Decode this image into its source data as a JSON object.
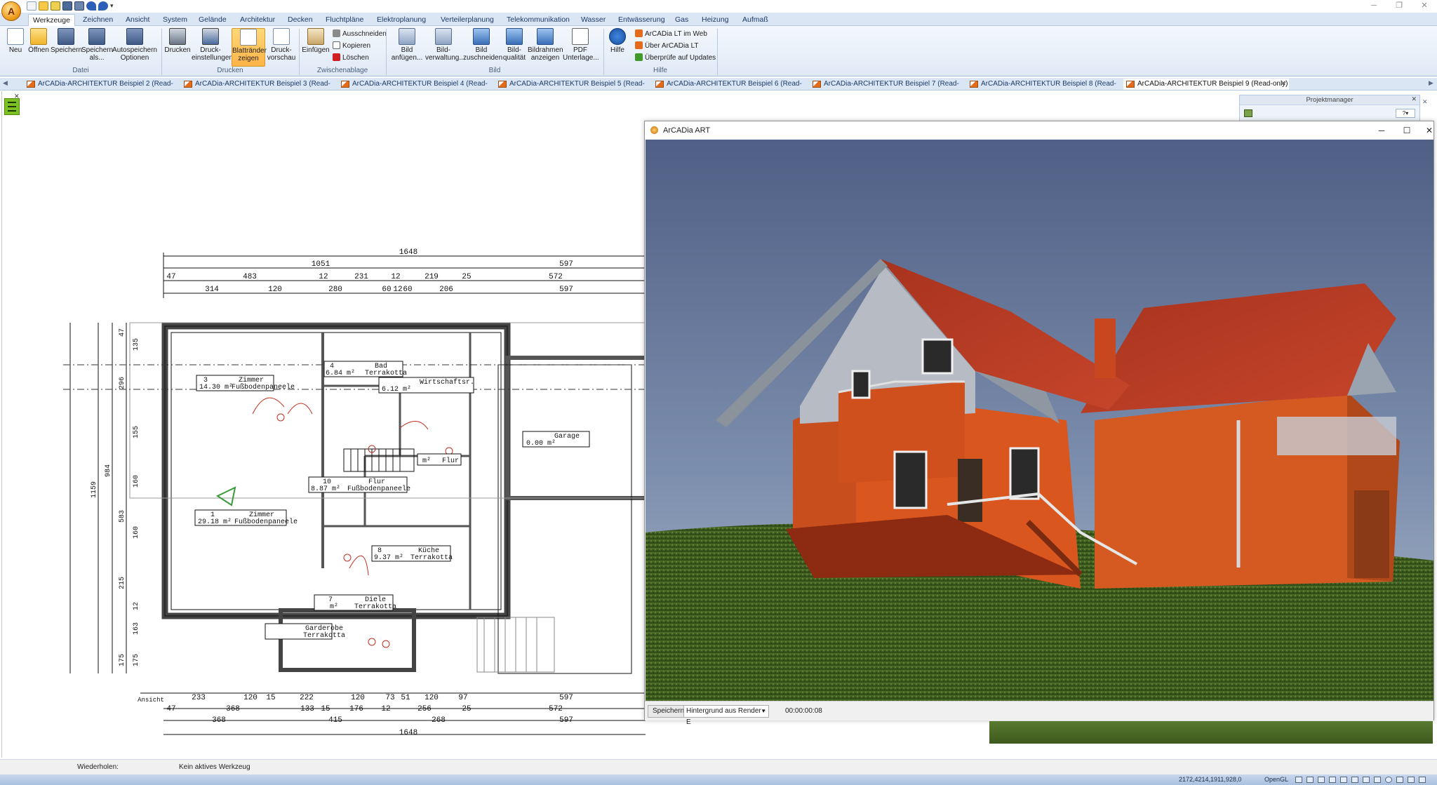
{
  "ribbon_tabs": [
    "Werkzeuge",
    "Zeichnen",
    "Ansicht",
    "System",
    "Gelände",
    "Architektur",
    "Decken",
    "Fluchtpläne",
    "Elektroplanung",
    "Verteilerplanung",
    "Telekommunikation",
    "Wasser",
    "Entwässerung",
    "Gas",
    "Heizung",
    "Aufmaß"
  ],
  "ribbon": {
    "datei": {
      "group": "Datei",
      "neu": "Neu",
      "oeffnen": "Öffnen",
      "speichern": "Speichern",
      "speichern_als": "Speichern als...",
      "autospeichern": "Autospeichern Optionen"
    },
    "drucken": {
      "group": "Drucken",
      "drucken": "Drucken",
      "druckeinstellungen": "Druck- einstellungen",
      "blattraender": "Blattränder zeigen",
      "druckvorschau": "Druck- vorschau"
    },
    "zwischenablage": {
      "group": "Zwischenablage",
      "einfuegen": "Einfügen",
      "ausschneiden": "Ausschneiden",
      "kopieren": "Kopieren",
      "loeschen": "Löschen"
    },
    "bild": {
      "group": "Bild",
      "anfuegen": "Bild anfügen...",
      "verwaltung": "Bild- verwaltung...",
      "zuschneiden": "Bild zuschneiden",
      "qualitaet": "Bild- qualität",
      "bildrahmen": "Bildrahmen anzeigen",
      "pdf": "PDF Unterlage..."
    },
    "hilfe": {
      "group": "Hilfe",
      "hilfe": "Hilfe",
      "web": "ArCADia LT im Web",
      "ueber": "Über ArCADia LT",
      "updates": "Überprüfe auf Updates"
    }
  },
  "doc_tabs": [
    "ArCADia-ARCHITEKTUR Beispiel 2 (Read-only)",
    "ArCADia-ARCHITEKTUR Beispiel 3 (Read-only)",
    "ArCADia-ARCHITEKTUR Beispiel 4 (Read-only)",
    "ArCADia-ARCHITEKTUR Beispiel 5 (Read-only)",
    "ArCADia-ARCHITEKTUR Beispiel 6 (Read-only)",
    "ArCADia-ARCHITEKTUR Beispiel 7 (Read-only)",
    "ArCADia-ARCHITEKTUR Beispiel 8 (Read-only)",
    "ArCADia-ARCHITEKTUR Beispiel 9 (Read-only)"
  ],
  "project_manager": {
    "title": "Projektmanager"
  },
  "plan": {
    "dims_top": [
      "1648",
      "1051",
      "597",
      "47",
      "483",
      "12",
      "231",
      "12",
      "219",
      "25",
      "572",
      "314",
      "120",
      "280",
      "60",
      "12",
      "60",
      "206",
      "597"
    ],
    "dims_bottom": [
      "Ansicht",
      "233",
      "120",
      "15",
      "222",
      "120",
      "73",
      "51",
      "120",
      "97",
      "597",
      "47",
      "368",
      "133",
      "15",
      "176",
      "12",
      "256",
      "25",
      "572",
      "368",
      "415",
      "268",
      "597",
      "1648"
    ],
    "dims_left": [
      "1159",
      "984",
      "47",
      "296",
      "135",
      "155",
      "160",
      "583",
      "160",
      "215",
      "12",
      "163",
      "175",
      "175"
    ],
    "rooms": [
      {
        "num": "3",
        "area": "14.30 m²",
        "name": "Zimmer",
        "floor": "Fußbodenpaneele"
      },
      {
        "num": "4",
        "area": "6.84 m²",
        "name": "Bad",
        "floor": "Terrakotta"
      },
      {
        "num": "",
        "area": "6.12 m²",
        "name": "Wirtschaftsr.",
        "floor": ""
      },
      {
        "num": "",
        "area": "0.00 m²",
        "name": "Garage",
        "floor": ""
      },
      {
        "num": "10",
        "area": "8.87 m²",
        "name": "Flur",
        "floor": "Fußbodenpaneele"
      },
      {
        "num": "1",
        "area": "29.18 m²",
        "name": "Zimmer",
        "floor": "Fußbodenpaneele"
      },
      {
        "num": "8",
        "area": "9.37 m²",
        "name": "Küche",
        "floor": "Terrakotta"
      },
      {
        "num": "7",
        "area": "m²",
        "name": "Diele",
        "floor": "Terrakotta"
      },
      {
        "num": "",
        "area": "",
        "name": "Garderobe",
        "floor": "Terrakotta"
      },
      {
        "num": "",
        "area": "m²",
        "name": "Flur",
        "floor": ""
      }
    ]
  },
  "art_window": {
    "title": "ArCADia ART",
    "save_button": "Speichern",
    "background_select": "Hintergrund aus Render -E",
    "elapsed": "00:00:00:08"
  },
  "status": {
    "repeat_label": "Wiederholen:",
    "tool": "Kein aktives Werkzeug",
    "coords": "2172,4214,1911,928,0",
    "renderer": "OpenGL"
  }
}
